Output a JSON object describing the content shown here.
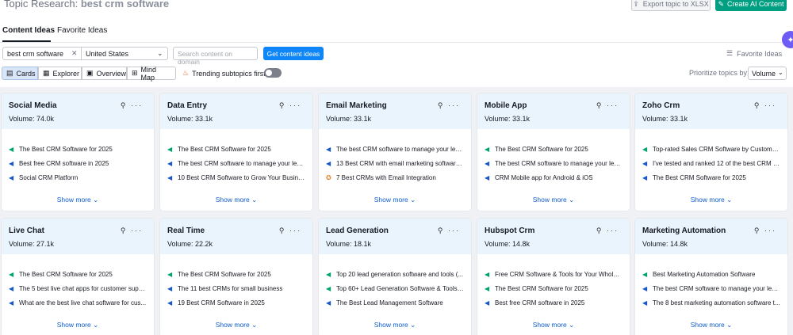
{
  "header": {
    "title_prefix": "Topic Research:",
    "query": "best crm software",
    "export_label": "Export topic to XLSX",
    "ai_label": "Create AI Content"
  },
  "tabs": [
    {
      "label": "Content Ideas"
    },
    {
      "label": "Favorite Ideas"
    }
  ],
  "search": {
    "keyword": "best crm software",
    "country": "United States",
    "domain_placeholder": "Search content on domain",
    "get_label": "Get content ideas",
    "favorite_link": "Favorite Ideas"
  },
  "views": {
    "cards": "Cards",
    "explorer": "Explorer",
    "overview": "Overview",
    "mindmap": "Mind Map",
    "trending": "Trending subtopics first",
    "prioritize": "Prioritize topics by:",
    "prioritize_value": "Volume"
  },
  "show_more": "Show more",
  "cards": [
    {
      "title": "Social Media",
      "volume": "Volume: 74.0k",
      "ideas": [
        {
          "icon": "g",
          "text": "The Best CRM Software for 2025"
        },
        {
          "icon": "b",
          "text": "Best free CRM software in 2025"
        },
        {
          "icon": "b",
          "text": "Social CRM Platform"
        }
      ]
    },
    {
      "title": "Data Entry",
      "volume": "Volume: 33.1k",
      "ideas": [
        {
          "icon": "g",
          "text": "The Best CRM Software for 2025"
        },
        {
          "icon": "b",
          "text": "The best CRM software to manage your lea..."
        },
        {
          "icon": "b",
          "text": "10 Best CRM Software to Grow Your Busine..."
        }
      ]
    },
    {
      "title": "Email Marketing",
      "volume": "Volume: 33.1k",
      "ideas": [
        {
          "icon": "b",
          "text": "The best CRM software to manage your lea..."
        },
        {
          "icon": "b",
          "text": "13 Best CRM with email marketing software ..."
        },
        {
          "icon": "o",
          "text": "7 Best CRMs with Email Integration"
        }
      ]
    },
    {
      "title": "Mobile App",
      "volume": "Volume: 33.1k",
      "ideas": [
        {
          "icon": "g",
          "text": "The Best CRM Software for 2025"
        },
        {
          "icon": "b",
          "text": "The best CRM software to manage your lea..."
        },
        {
          "icon": "b",
          "text": "CRM Mobile app for Android & iOS"
        }
      ]
    },
    {
      "title": "Zoho Crm",
      "volume": "Volume: 33.1k",
      "ideas": [
        {
          "icon": "g",
          "text": "Top-rated Sales CRM Software by Customers"
        },
        {
          "icon": "b",
          "text": "I've tested and ranked 12 of the best CRM p..."
        },
        {
          "icon": "b",
          "text": "The Best CRM Software for 2025"
        }
      ]
    },
    {
      "title": "Live Chat",
      "volume": "Volume: 27.1k",
      "ideas": [
        {
          "icon": "g",
          "text": "The Best CRM Software for 2025"
        },
        {
          "icon": "b",
          "text": "The 5 best live chat apps for customer supp..."
        },
        {
          "icon": "b",
          "text": "What are the best live chat software for cus..."
        }
      ]
    },
    {
      "title": "Real Time",
      "volume": "Volume: 22.2k",
      "ideas": [
        {
          "icon": "g",
          "text": "The Best CRM Software for 2025"
        },
        {
          "icon": "b",
          "text": "The 11 best CRMs for small business"
        },
        {
          "icon": "b",
          "text": "19 Best CRM Software in 2025"
        }
      ]
    },
    {
      "title": "Lead Generation",
      "volume": "Volume: 18.1k",
      "ideas": [
        {
          "icon": "g",
          "text": "Top 20 lead generation software and tools (..."
        },
        {
          "icon": "g",
          "text": "Top 60+ Lead Generation Software & Tools ..."
        },
        {
          "icon": "b",
          "text": "The Best Lead Management Software"
        }
      ]
    },
    {
      "title": "Hubspot Crm",
      "volume": "Volume: 14.8k",
      "ideas": [
        {
          "icon": "g",
          "text": "Free CRM Software & Tools for Your Whole ..."
        },
        {
          "icon": "g",
          "text": "The Best CRM Software for 2025"
        },
        {
          "icon": "b",
          "text": "Best free CRM software in 2025"
        }
      ]
    },
    {
      "title": "Marketing Automation",
      "volume": "Volume: 14.8k",
      "ideas": [
        {
          "icon": "g",
          "text": "Best Marketing Automation Software"
        },
        {
          "icon": "b",
          "text": "The best CRM software to manage your lea..."
        },
        {
          "icon": "b",
          "text": "The 8 best marketing automation software t..."
        }
      ]
    }
  ]
}
